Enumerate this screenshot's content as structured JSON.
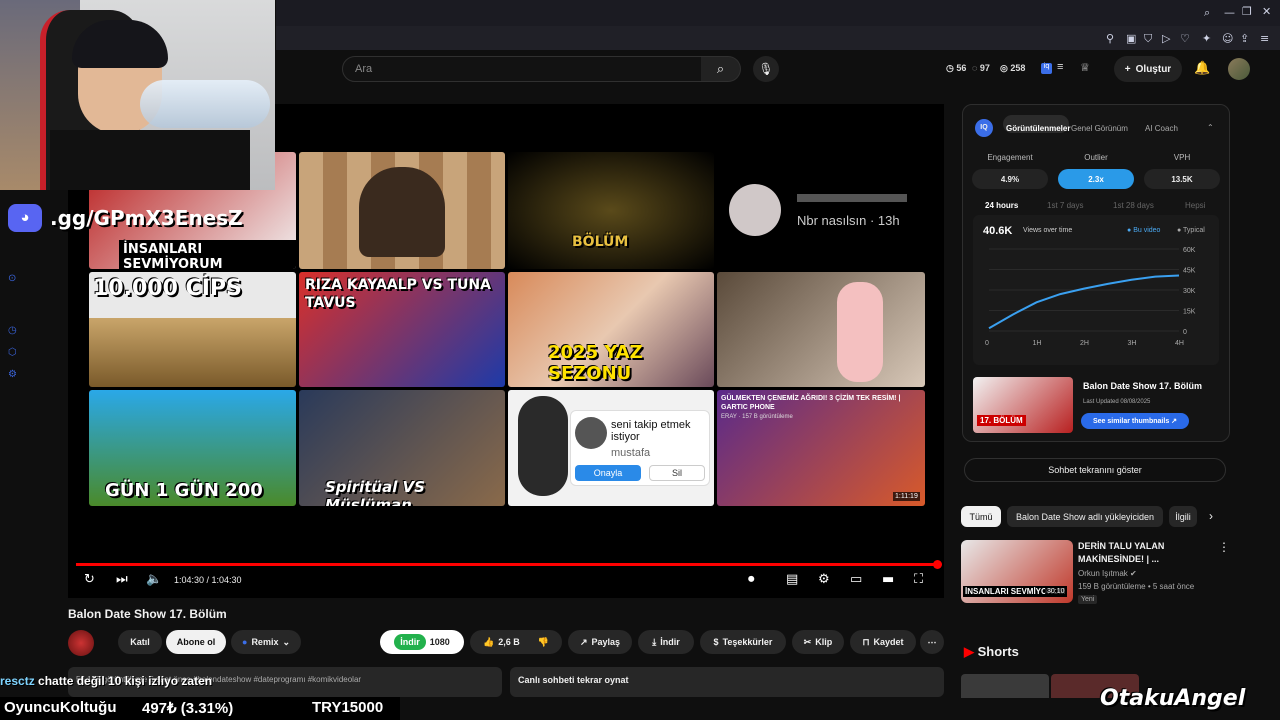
{
  "search": {
    "placeholder": "Ara"
  },
  "header": {
    "stats": [
      {
        "icon": "eye-icon",
        "value": "56"
      },
      {
        "icon": "eye-icon",
        "value": "97"
      },
      {
        "icon": "eye-icon",
        "value": "258"
      }
    ],
    "create_label": "Oluştur"
  },
  "overlay": {
    "discord_text": ".gg/GPmX3EnesZ",
    "chat_user": "resctz",
    "chat_msg": "chatte değil 10 kişi izliyo zaten",
    "ticker_name": "OyuncuKoltuğu",
    "ticker_price": "497₺ (3.31%)",
    "ticker_goal": "TRY15000",
    "brand": "OtakuAngel"
  },
  "endscreen": {
    "tiles": [
      {
        "caption": "İNSANLARI SEVMİYORUM"
      },
      {
        "caption": ""
      },
      {
        "caption": "BÖLÜM"
      },
      {
        "caption": "Nbr nasılsın · 13h"
      },
      {
        "caption": "10.000 CİPS"
      },
      {
        "caption": "RIZA KAYAALP VS TUNA TAVUS"
      },
      {
        "caption": "2025 YAZ SEZONU"
      },
      {
        "caption": ""
      },
      {
        "caption": "GÜN 1   GÜN 200"
      },
      {
        "caption": "Spiritüal VS Müslüman"
      },
      {
        "caption": "seni takip etmek istiyor"
      },
      {
        "caption": "GÜLMEKTEN ÇENEMİZ AĞRIDI! 3 ÇİZİM TEK RESİM! | GARTIC PHONE"
      }
    ],
    "tile2_sub": "mustafa",
    "tile2_accept": "Onayla",
    "tile2_delete": "Sil",
    "tile3_sub": "ERAY · 157 B görüntüleme",
    "tile3_duration": "1:11:19"
  },
  "player": {
    "time": "1:04:30 / 1:04:30"
  },
  "video": {
    "title": "Balon Date Show 17. Bölüm",
    "join_label": "Katıl",
    "subscribed_label": "Abone ol",
    "remix_label": "Remix",
    "download_green": "İndir",
    "quality": "1080",
    "likes": "2,6 B",
    "share": "Paylaş",
    "download": "İndir",
    "thanks": "Teşekkürler",
    "clip": "Klip",
    "save": "Kaydet",
    "desc": "56.138 görüntüleme  5 saat önce  #balondateshow #dateprogramı #komikvideolar",
    "chat_replay": "Canlı sohbeti tekrar oynat"
  },
  "vidiq": {
    "tabs": [
      "Görüntülenmeler",
      "Genel Görünüm",
      "AI Coach"
    ],
    "metric_labels": [
      "Engagement",
      "Outlier",
      "VPH"
    ],
    "metric_values": [
      "4.9%",
      "2.3x",
      "13.5K"
    ],
    "ranges": [
      "24 hours",
      "1st 7 days",
      "1st 28 days",
      "Hepsi"
    ],
    "views": "40.6K",
    "views_select": "Views over time",
    "legend_this": "Bu video",
    "legend_typical": "Typical",
    "y_ticks": [
      "60K",
      "45K",
      "30K",
      "15K",
      "0"
    ],
    "x_ticks": [
      "0",
      "1H",
      "2H",
      "3H",
      "4H"
    ],
    "card_title": "Balon Date Show 17. Bölüm",
    "card_updated": "Last Updated 08/08/2025",
    "card_button": "See similar thumbnails",
    "card_thumb_badge": "17. BÖLÜM"
  },
  "chart_data": {
    "type": "line",
    "x": [
      0,
      0.5,
      1,
      1.5,
      2,
      2.5,
      3,
      3.5,
      4
    ],
    "xlabel": "",
    "ylabel": "",
    "ylim": [
      0,
      60000
    ],
    "series": [
      {
        "name": "Bu video",
        "values": [
          2000,
          12000,
          21000,
          27000,
          31000,
          34500,
          37500,
          39800,
          40600
        ]
      }
    ]
  },
  "sidebar": {
    "chat_button": "Sohbet tekranını göster",
    "chips": [
      "Tümü",
      "Balon Date Show adlı yükleyiciden",
      "İlgili"
    ],
    "rec": {
      "title": "DERİN TALU YALAN MAKİNESİNDE! | ...",
      "channel": "Orkun Işıtmak",
      "meta": "159 B görüntüleme • 5 saat önce",
      "badge": "Yeni",
      "duration": "30:10",
      "thumb_caption": "İNSANLARI SEVMİYORUM"
    },
    "shorts": "Shorts"
  }
}
